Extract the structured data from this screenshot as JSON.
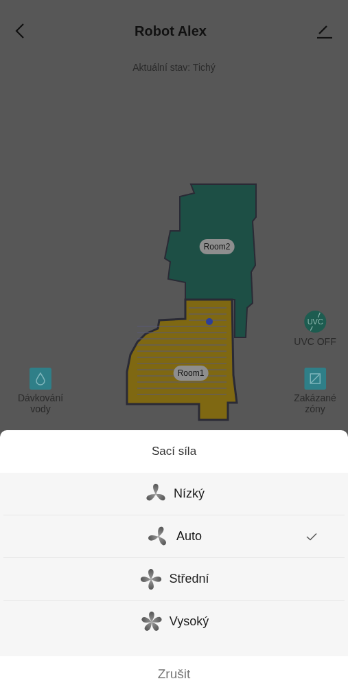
{
  "header": {
    "title": "Robot Alex"
  },
  "status": "Aktuální stav: Tichý",
  "map": {
    "rooms": [
      {
        "label": "Room2",
        "kind": "green"
      },
      {
        "label": "Room1",
        "kind": "yellow"
      }
    ]
  },
  "uvc": {
    "icon_text": "UVC",
    "label": "UVC OFF",
    "on": false
  },
  "side_buttons": [
    {
      "kind": "water",
      "lines": [
        "Dávkování",
        "vody"
      ]
    },
    {
      "kind": "zones",
      "lines": [
        "Zakázané",
        "zóny"
      ]
    }
  ],
  "sheet": {
    "title": "Sací síla",
    "options": [
      {
        "label": "Nízký",
        "kind": "low",
        "selected": false
      },
      {
        "label": "Auto",
        "kind": "auto",
        "selected": true
      },
      {
        "label": "Střední",
        "kind": "medium",
        "selected": false
      },
      {
        "label": "Vysoký",
        "kind": "high",
        "selected": false
      }
    ],
    "cancel": "Zrušit"
  }
}
